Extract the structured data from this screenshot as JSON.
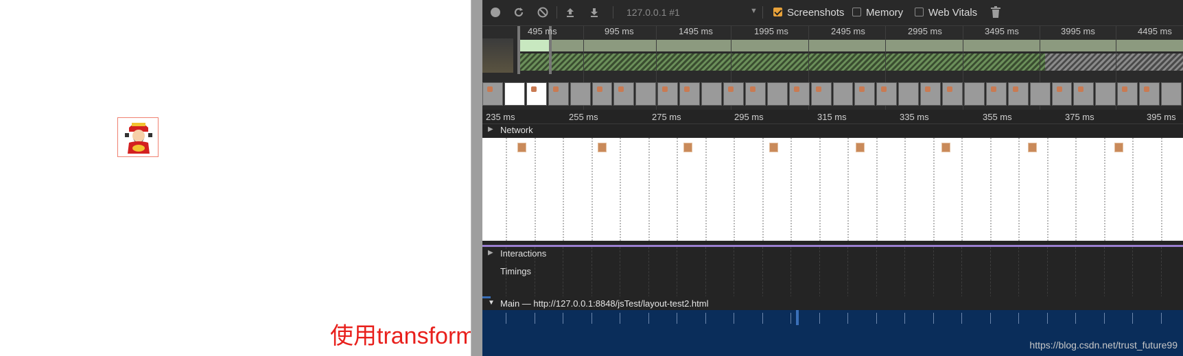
{
  "page": {
    "caption": "使用transform"
  },
  "toolbar": {
    "record_icon": "record-icon",
    "reload_icon": "reload-icon",
    "clear_icon": "clear-icon",
    "upload_icon": "upload-icon",
    "download_icon": "download-icon",
    "target": "127.0.0.1 #1",
    "screenshots_label": "Screenshots",
    "screenshots_checked": true,
    "memory_label": "Memory",
    "memory_checked": false,
    "webvitals_label": "Web Vitals",
    "webvitals_checked": false,
    "trash_icon": "trash-icon"
  },
  "overview": {
    "ticks": [
      "495 ms",
      "995 ms",
      "1495 ms",
      "1995 ms",
      "2495 ms",
      "2995 ms",
      "3495 ms",
      "3995 ms",
      "4495 ms"
    ]
  },
  "ruler": {
    "ticks": [
      "235 ms",
      "255 ms",
      "275 ms",
      "295 ms",
      "315 ms",
      "335 ms",
      "355 ms",
      "375 ms",
      "395 ms"
    ]
  },
  "sections": {
    "network": "Network",
    "interactions": "Interactions",
    "timings": "Timings",
    "main": "Main — http://127.0.0.1:8848/jsTest/layout-test2.html"
  },
  "watermark": "https://blog.csdn.net/trust_future99",
  "colors": {
    "accent_checkbox": "#e8a23a",
    "main_track": "#0a2d5a",
    "caption": "#e8201c",
    "interactions_line": "#9b7fd0"
  }
}
